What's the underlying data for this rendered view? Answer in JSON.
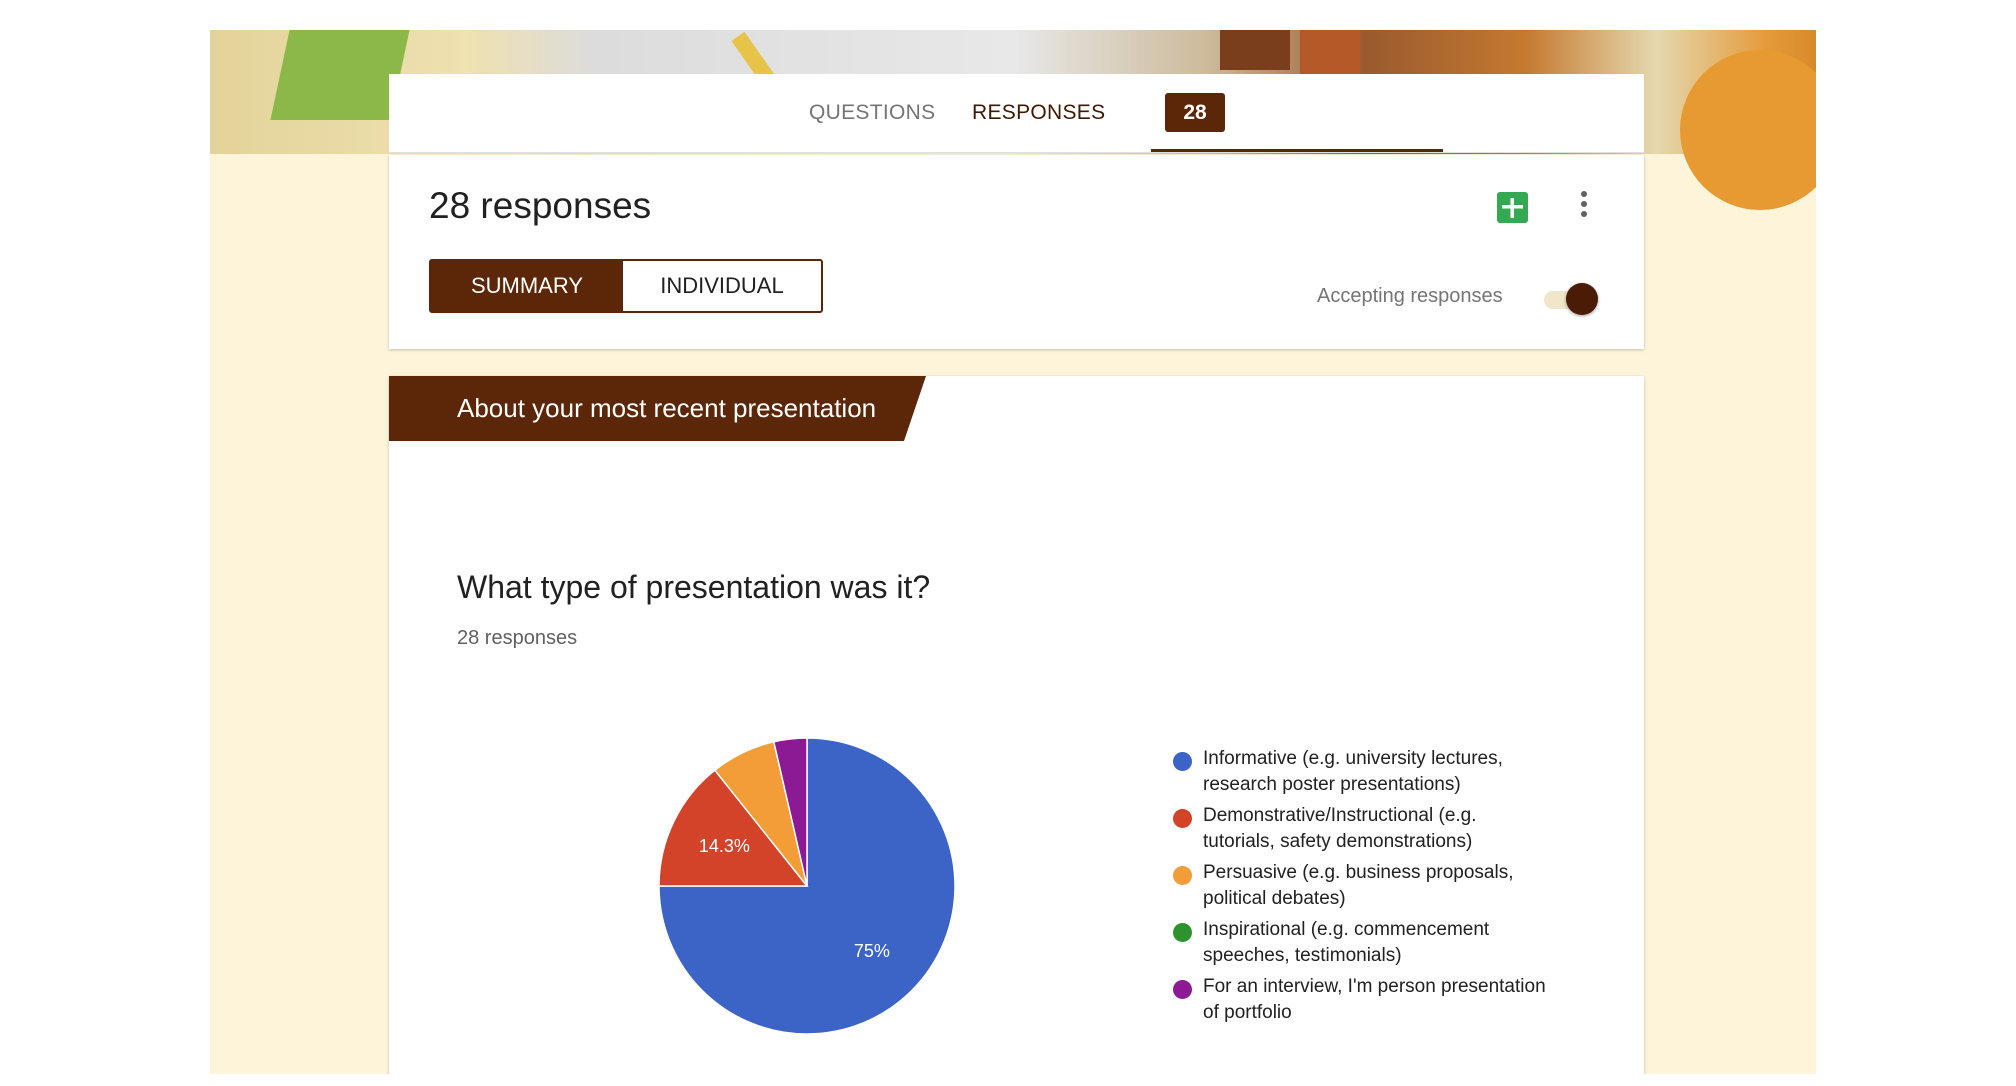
{
  "tabs": {
    "questions_label": "QUESTIONS",
    "responses_label": "RESPONSES",
    "responses_count": "28"
  },
  "summary": {
    "title": "28 responses",
    "summary_button": "SUMMARY",
    "individual_button": "INDIVIDUAL",
    "accepting_label": "Accepting responses",
    "accepting_on": true
  },
  "section": {
    "title": "About your most recent presentation"
  },
  "question": {
    "title": "What type of presentation was it?",
    "response_count": "28 responses"
  },
  "icons": {
    "sheets": "sheets-icon",
    "more": "more-vert-icon"
  },
  "colors": {
    "accent": "#5c2708",
    "background": "#fdf4d9"
  },
  "chart_data": {
    "type": "pie",
    "slices": [
      {
        "label": "Informative (e.g. university lectures, research poster presentations)",
        "value": 75,
        "display": "75%",
        "color": "#3b64c6"
      },
      {
        "label": "Demonstrative/Instructional (e.g. tutorials, safety demonstrations)",
        "value": 14.3,
        "display": "14.3%",
        "color": "#d2432a"
      },
      {
        "label": "Persuasive (e.g. business proposals, political debates)",
        "value": 7.1,
        "display": "",
        "color": "#f29d38"
      },
      {
        "label": "Inspirational (e.g. commencement speeches, testimonials)",
        "value": 0,
        "display": "",
        "color": "#2e922e"
      },
      {
        "label": "For an interview, I'm person presentation of portfolio",
        "value": 3.6,
        "display": "",
        "color": "#8c1a94"
      }
    ],
    "legend_position": "right"
  }
}
